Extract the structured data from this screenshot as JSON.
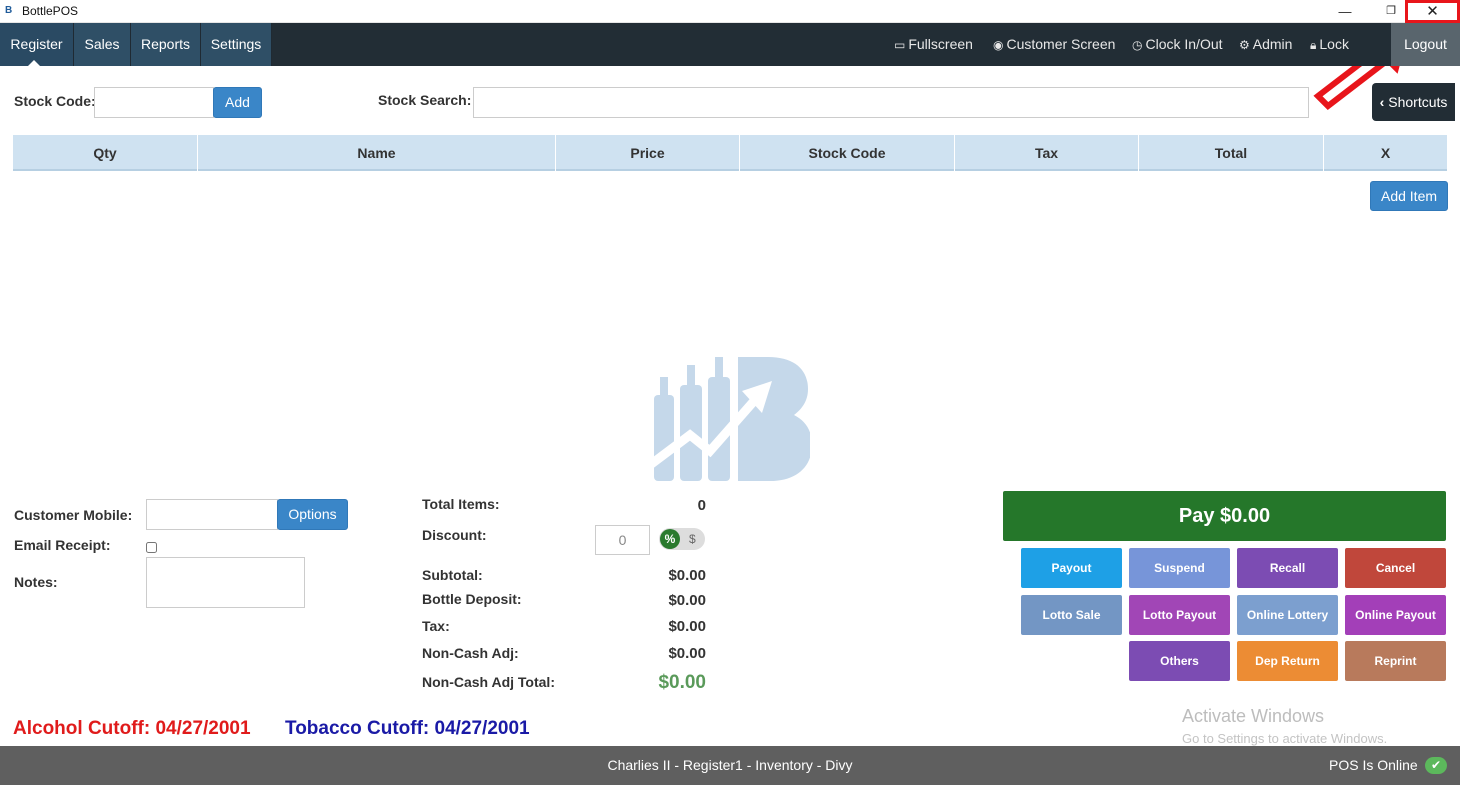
{
  "window": {
    "title": "BottlePOS",
    "app_icon_text": "B",
    "minimize": "—",
    "maximize": "❐",
    "close": "✕"
  },
  "nav": {
    "tabs": [
      {
        "label": "Register"
      },
      {
        "label": "Sales"
      },
      {
        "label": "Reports"
      },
      {
        "label": "Settings"
      }
    ],
    "right": {
      "fullscreen": "Fullscreen",
      "customer_screen": "Customer Screen",
      "clock": "Clock In/Out",
      "admin": "Admin",
      "lock": "Lock",
      "logout": "Logout"
    }
  },
  "stock": {
    "code_label": "Stock Code:",
    "code_value": "",
    "add_label": "Add",
    "search_label": "Stock Search:",
    "search_value": "",
    "shortcuts_label": "Shortcuts"
  },
  "table": {
    "columns": [
      "Qty",
      "Name",
      "Price",
      "Stock Code",
      "Tax",
      "Total",
      "X"
    ],
    "rows": [],
    "add_item_label": "Add Item"
  },
  "customer": {
    "mobile_label": "Customer Mobile:",
    "mobile_value": "",
    "options_label": "Options",
    "email_label": "Email Receipt:",
    "email_checked": false,
    "notes_label": "Notes:",
    "notes_value": ""
  },
  "totals": {
    "total_items_label": "Total Items:",
    "total_items": "0",
    "discount_label": "Discount:",
    "discount_value": "0",
    "discount_percent": "%",
    "discount_dollar": "$",
    "subtotal_label": "Subtotal:",
    "subtotal": "$0.00",
    "bottle_deposit_label": "Bottle Deposit:",
    "bottle_deposit": "$0.00",
    "tax_label": "Tax:",
    "tax": "$0.00",
    "noncash_adj_label": "Non-Cash Adj:",
    "noncash_adj": "$0.00",
    "noncash_total_label": "Non-Cash Adj Total:",
    "noncash_total": "$0.00"
  },
  "actions": {
    "pay": "Pay $0.00",
    "payout": "Payout",
    "suspend": "Suspend",
    "recall": "Recall",
    "cancel": "Cancel",
    "lotto_sale": "Lotto Sale",
    "lotto_payout": "Lotto Payout",
    "online_lottery": "Online Lottery",
    "online_payout": "Online Payout",
    "others": "Others",
    "dep_return": "Dep Return",
    "reprint": "Reprint"
  },
  "cutoffs": {
    "alcohol": "Alcohol Cutoff: 04/27/2001",
    "tobacco": "Tobacco Cutoff: 04/27/2001",
    "alcohol_color": "#e01b1b",
    "tobacco_color": "#1a1aa6"
  },
  "watermark": {
    "line1": "Activate Windows",
    "line2": "Go to Settings to activate Windows."
  },
  "footer": {
    "center": "Charlies II - Register1 - Inventory - Divy",
    "status": "POS Is Online",
    "status_icon": "✔"
  },
  "colors": {
    "accent": "#3a86c8",
    "pay": "#25772a",
    "nav_bg": "#222d35",
    "footer_bg": "#5f5f5f"
  }
}
